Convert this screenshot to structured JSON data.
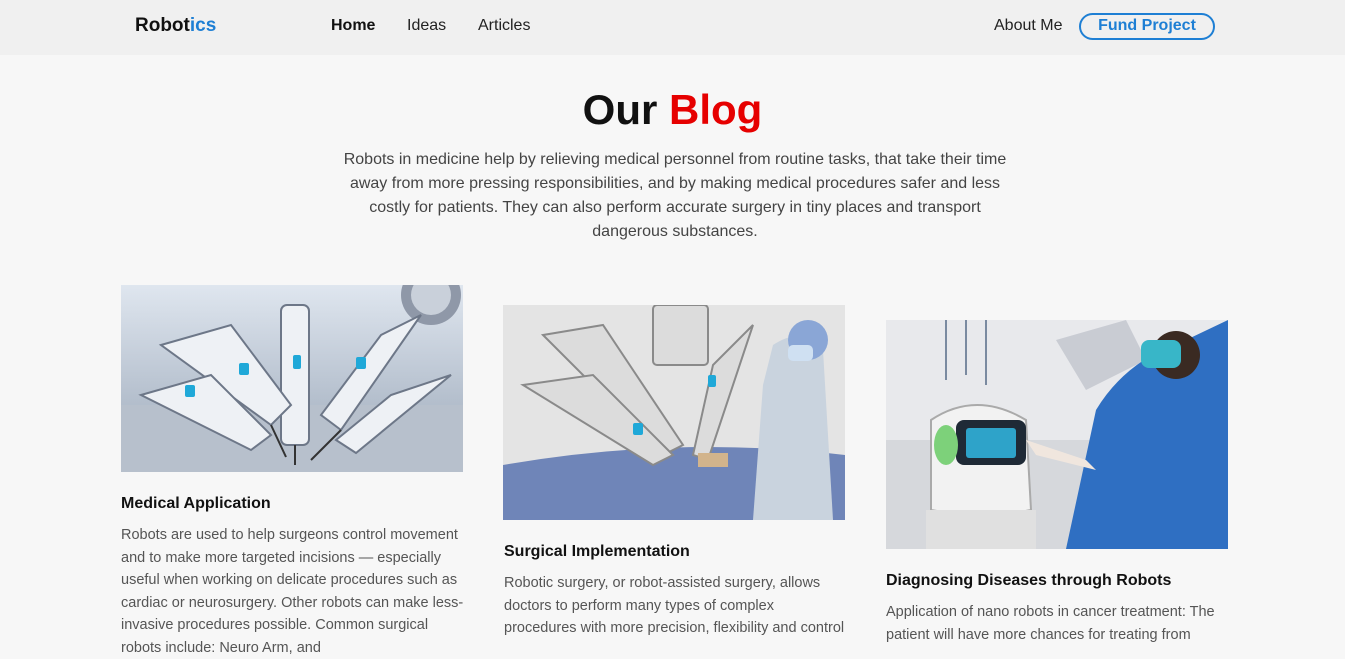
{
  "nav": {
    "logo_main": "Robot",
    "logo_accent": "ics",
    "links": [
      "Home",
      "Ideas",
      "Articles"
    ],
    "about": "About Me",
    "fund": "Fund Project"
  },
  "hero": {
    "title_plain": "Our",
    "title_accent": "Blog",
    "text": "Robots in medicine help by relieving medical personnel from routine tasks, that take their time away from more pressing responsibilities, and by making medical procedures safer and less costly for patients. They can also perform accurate surgery in tiny places and transport dangerous substances."
  },
  "cards": [
    {
      "title": "Medical Application",
      "text": "Robots are used to help surgeons control movement and to make more targeted incisions — especially useful when working on delicate procedures such as cardiac or neurosurgery. Other robots can make less-invasive procedures possible. Common surgical robots include: Neuro Arm, and"
    },
    {
      "title": "Surgical Implementation",
      "text": "Robotic surgery, or robot-assisted surgery, allows doctors to perform many types of complex procedures with more precision, flexibility and control"
    },
    {
      "title": "Diagnosing Diseases through Robots",
      "text": "Application of nano robots in cancer treatment: The patient will have more chances for treating from"
    }
  ],
  "colors": {
    "accent_blue": "#1e7fd4",
    "accent_red": "#e60000"
  }
}
